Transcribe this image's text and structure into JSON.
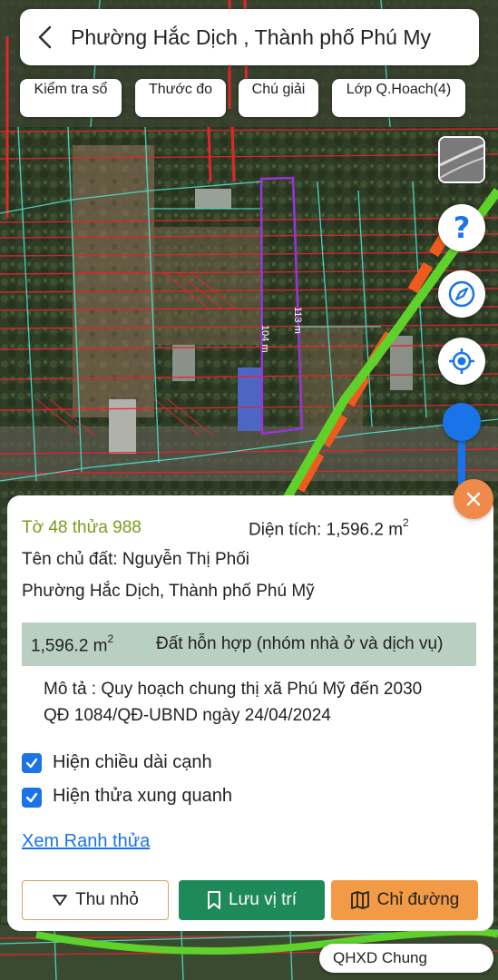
{
  "header": {
    "title": "Phường Hắc Dịch , Thành phố Phú My"
  },
  "toolbar": {
    "check_book": "Kiểm tra sổ",
    "measure": "Thước đo",
    "legend": "Chú giải",
    "layers": "Lớp Q.Hoach(4)"
  },
  "map": {
    "edge_left_length": "104 m",
    "edge_right_length": "113 m"
  },
  "parcel": {
    "sheet_parcel": "Tờ 48 thửa 988",
    "area_label": "Diện tích: 1,596.2 m",
    "area_unit_sup": "2",
    "owner": "Tên chủ đất: Nguyễn Thị Phối",
    "address": "Phường Hắc Dịch, Thành phố Phú Mỹ",
    "zone_area": "1,596.2 m",
    "zone_area_sup": "2",
    "zone_type": "Đất hỗn hợp (nhóm nhà ở và dịch vụ)",
    "description_line1": "Mô tả : Quy hoạch chung thị xã Phú Mỹ đến 2030",
    "description_line2": "QĐ 1084/QĐ-UBND ngày 24/04/2024",
    "show_edge_length": "Hiện chiều dài cạnh",
    "show_edge_length_checked": true,
    "show_neighbors": "Hiện thửa xung quanh",
    "show_neighbors_checked": true,
    "view_boundary_link": "Xem Ranh thửa"
  },
  "actions": {
    "shrink": "Thu nhỏ",
    "save_location": "Lưu vị trí",
    "directions": "Chỉ đường"
  },
  "plan_chip": "QHXD Chung",
  "colors": {
    "parcel_green": "#7a9b1d",
    "blue": "#1a73e8",
    "save_green": "#1e8a5a",
    "orange": "#f29a45",
    "zone_row": "#b8cfc2"
  },
  "icons": [
    "back-arrow-icon",
    "help-icon",
    "compass-icon",
    "locate-icon",
    "close-icon",
    "chevron-down-icon",
    "bookmark-icon",
    "map-icon",
    "checkbox-checked-icon"
  ]
}
